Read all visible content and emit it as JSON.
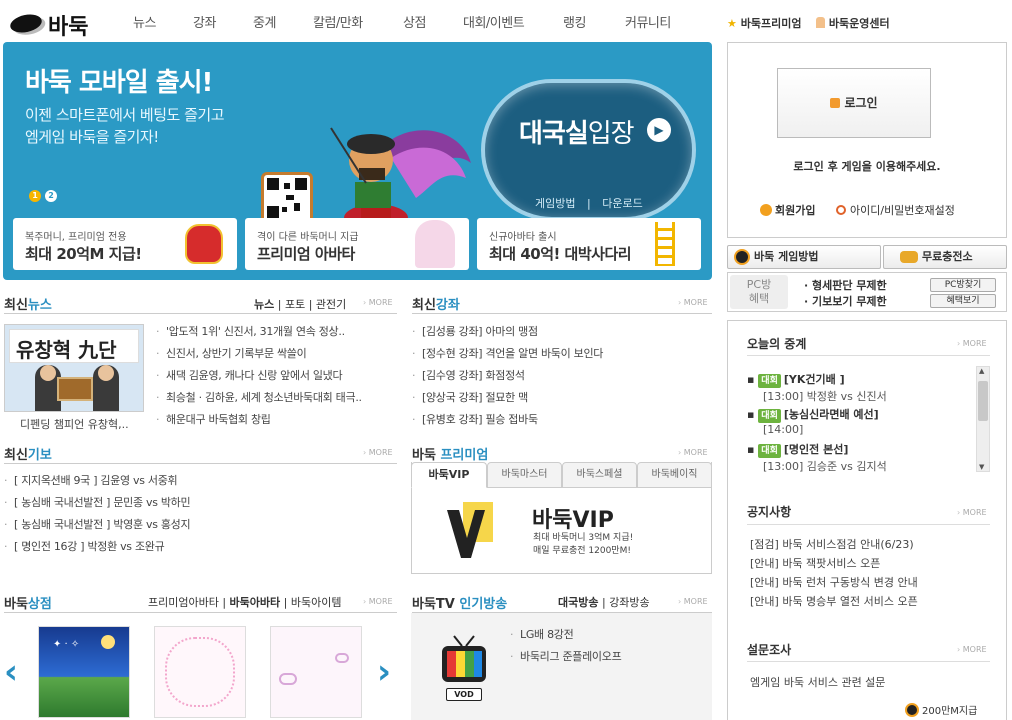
{
  "header": {
    "logo_text": "바둑",
    "nav": [
      "뉴스",
      "강좌",
      "중계",
      "칼럼/만화",
      "상점",
      "대회/이벤트",
      "랭킹",
      "커뮤니티"
    ],
    "premium_link": "바둑프리미엄",
    "center_link": "바둑운영센터"
  },
  "banner": {
    "title": "바둑 모바일 출시!",
    "sub1": "이젠 스마트폰에서 베팅도 즐기고",
    "sub2": "엠게임 바둑을 즐기자!",
    "enter_a": "대국실",
    "enter_b": "입장",
    "enter_how": "게임방법",
    "enter_sep": "|",
    "enter_download": "다운로드",
    "dot1": "1",
    "dot2": "2",
    "promos": [
      {
        "small": "복주머니, 프리미엄 전용",
        "big": "최대 20억M 지급!"
      },
      {
        "small": "격이 다른 바둑머니 지급",
        "big": "프리미엄 아바타"
      },
      {
        "small": "신규아바타 출시",
        "big": "최대 40억! 대박사다리"
      }
    ]
  },
  "news": {
    "title_a": "최신",
    "title_b": "뉴스",
    "tabs": [
      "뉴스",
      "포토",
      "관전기"
    ],
    "more": "MORE",
    "photo_board": "유창혁 九단",
    "photo_caption": "디펜딩 챔피언 유창혁,..",
    "items": [
      "'압도적 1위' 신진서, 31개월 연속 정상..",
      "신진서, 상반기 기록부문 싹쓸이",
      "새댁 김윤영, 캐나다 신랑 앞에서 일냈다",
      "최승철 · 김하윤, 세계 청소년바둑대회 태극..",
      "해운대구 바둑협회 창립"
    ]
  },
  "lectures": {
    "title_a": "최신",
    "title_b": "강좌",
    "more": "MORE",
    "items": [
      "[김성룡 강좌] 아마의 맹점",
      "[정수현 강좌] 격언을 알면 바둑이 보인다",
      "[김수영 강좌] 화점정석",
      "[양상국 강좌] 절묘한 맥",
      "[유병호 강좌] 필승 접바둑"
    ]
  },
  "records": {
    "title_a": "최신",
    "title_b": "기보",
    "more": "MORE",
    "items": [
      "[ 지지옥션배 9국 ] 김윤영 vs 서중휘",
      "[ 농심배 국내선발전 ] 문민종 vs 박하민",
      "[ 농심배 국내선발전 ] 박영훈 vs 홍성지",
      "[ 명인전 16강 ] 박정환 vs 조완규"
    ]
  },
  "premium": {
    "title_a": "바둑 ",
    "title_b": "프리미엄",
    "more": "MORE",
    "tabs": [
      "바둑VIP",
      "바둑마스터",
      "바둑스페셜",
      "바둑베이직"
    ],
    "vip_name": "바둑VIP",
    "vip_line1": "최대 바둑머니 3억M 지급!",
    "vip_line2": "매일 무료충전 1200만M!"
  },
  "shop": {
    "title_a": "바둑",
    "title_b": "상점",
    "tabs": [
      "프리미엄아바타",
      "바둑아바타",
      "바둑아이템"
    ],
    "more": "MORE",
    "prev": "‹",
    "next": "›"
  },
  "tv": {
    "title_a": "바둑TV ",
    "title_b": "인기방송",
    "tabs": [
      "대국방송",
      "강좌방송"
    ],
    "more": "MORE",
    "vod": "VOD",
    "items": [
      "LG배 8강전",
      "바둑리그 준플레이오프"
    ]
  },
  "login": {
    "button": "로그인",
    "message": "로그인 후 게임을 이용해주세요.",
    "join": "회원가입",
    "find": "아이디/비밀번호재설정"
  },
  "quick": {
    "how_to": "바둑 게임방법",
    "free_charge": "무료충전소"
  },
  "pcbang": {
    "label_a": "PC방",
    "label_b": "혜택",
    "benefit1": "· 형세판단 무제한",
    "benefit2": "· 기보보기 무제한",
    "btn_find": "PC방찾기",
    "btn_benefit": "혜택보기"
  },
  "live": {
    "title": "오늘의 중계",
    "more": "MORE",
    "badge": "대회",
    "items": [
      {
        "name": "[YK건기배 ]",
        "sub": "[13:00] 박정환 vs 신진서"
      },
      {
        "name": "[농심신라면배 예선]",
        "sub": "[14:00]"
      },
      {
        "name": "[명인전 본선]",
        "sub": "[13:00] 김승준 vs 김지석"
      }
    ]
  },
  "notice": {
    "title": "공지사항",
    "more": "MORE",
    "items": [
      "[점검] 바둑 서비스점검 안내(6/23)",
      "[안내] 바둑 잭팟서비스 오픈",
      "[안내] 바둑 런처 구동방식 변경 안내",
      "[안내] 바둑 명승부 열전 서비스 오픈"
    ]
  },
  "survey": {
    "title": "설문조사",
    "more": "MORE",
    "item": "엠게임 바둑 서비스 관련 설문",
    "reward": "200만M지급"
  },
  "colors": {
    "banner_blue": "#2b9ac5",
    "accent_blue": "#2a8fc1",
    "live_badge_green": "#6db33f"
  }
}
